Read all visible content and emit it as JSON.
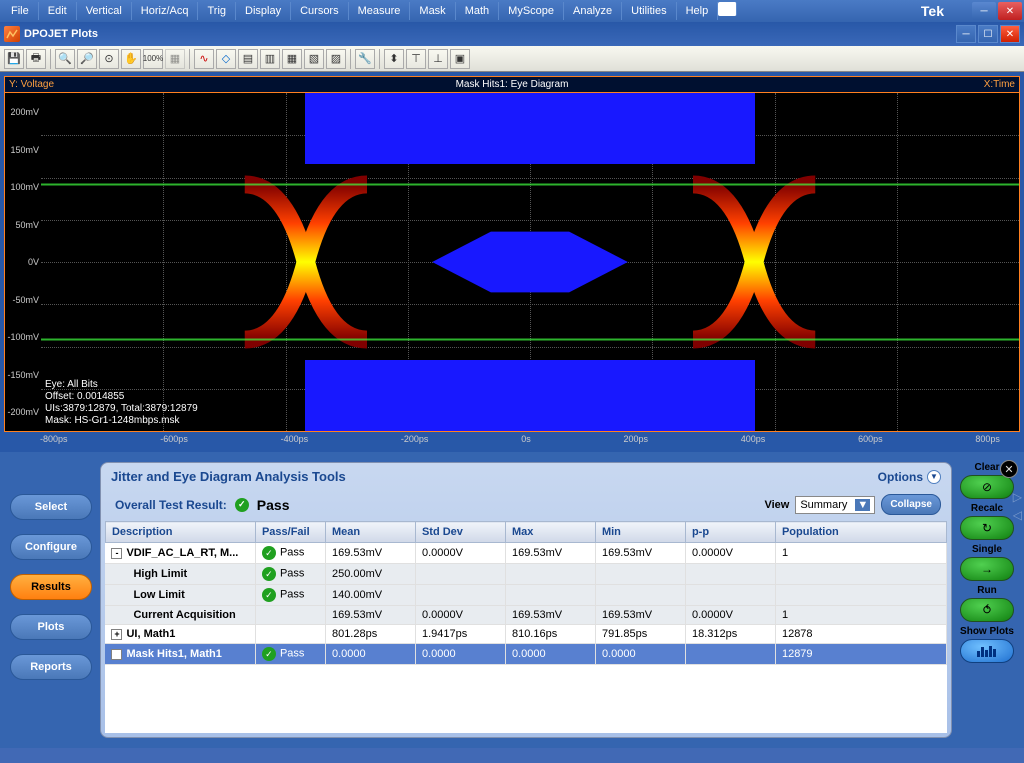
{
  "menu": {
    "items": [
      "File",
      "Edit",
      "Vertical",
      "Horiz/Acq",
      "Trig",
      "Display",
      "Cursors",
      "Measure",
      "Mask",
      "Math",
      "MyScope",
      "Analyze",
      "Utilities",
      "Help"
    ],
    "brand": "Tek"
  },
  "window": {
    "title": "DPOJET Plots"
  },
  "plot": {
    "yLabel": "Y: Voltage",
    "title": "Mask Hits1: Eye Diagram",
    "xLabel": "X:Time",
    "yTicks": [
      "200mV",
      "150mV",
      "100mV",
      "50mV",
      "0V",
      "-50mV",
      "-100mV",
      "-150mV",
      "-200mV"
    ],
    "xTicks": [
      "-800ps",
      "-600ps",
      "-400ps",
      "-200ps",
      "0s",
      "200ps",
      "400ps",
      "600ps",
      "800ps"
    ],
    "info": {
      "l1": "Eye: All Bits",
      "l2": "Offset: 0.0014855",
      "l3": "UIs:3879:12879, Total:3879:12879",
      "l4": "Mask: HS-Gr1-1248mbps.msk"
    }
  },
  "analysis": {
    "title": "Jitter and Eye Diagram Analysis Tools",
    "options": "Options",
    "overallLabel": "Overall Test Result:",
    "overallResult": "Pass",
    "viewLabel": "View",
    "viewValue": "Summary",
    "collapse": "Collapse",
    "leftButtons": [
      "Select",
      "Configure",
      "Results",
      "Plots",
      "Reports"
    ],
    "headers": [
      "Description",
      "Pass/Fail",
      "Mean",
      "Std Dev",
      "Max",
      "Min",
      "p-p",
      "Population"
    ],
    "rows": [
      {
        "type": "main",
        "toggle": "-",
        "cells": [
          "VDIF_AC_LA_RT, M...",
          "Pass",
          "169.53mV",
          "0.0000V",
          "169.53mV",
          "169.53mV",
          "0.0000V",
          "1"
        ],
        "passicon": true
      },
      {
        "type": "sub",
        "cells": [
          "High Limit",
          "Pass",
          "250.00mV",
          "",
          "",
          "",
          "",
          ""
        ],
        "passicon": true
      },
      {
        "type": "sub",
        "cells": [
          "Low Limit",
          "Pass",
          "140.00mV",
          "",
          "",
          "",
          "",
          ""
        ],
        "passicon": true
      },
      {
        "type": "sub",
        "cells": [
          "Current Acquisition",
          "",
          "169.53mV",
          "0.0000V",
          "169.53mV",
          "169.53mV",
          "0.0000V",
          "1"
        ]
      },
      {
        "type": "main",
        "toggle": "+",
        "cells": [
          "UI, Math1",
          "",
          "801.28ps",
          "1.9417ps",
          "810.16ps",
          "791.85ps",
          "18.312ps",
          "12878"
        ]
      },
      {
        "type": "main selected",
        "toggle": "+",
        "cells": [
          "Mask Hits1, Math1",
          "Pass",
          "0.0000",
          "0.0000",
          "0.0000",
          "0.0000",
          "",
          "12879"
        ],
        "passicon": true
      }
    ],
    "rightButtons": {
      "clear": "Clear",
      "recalc": "Recalc",
      "single": "Single",
      "run": "Run",
      "showPlots": "Show Plots"
    }
  }
}
